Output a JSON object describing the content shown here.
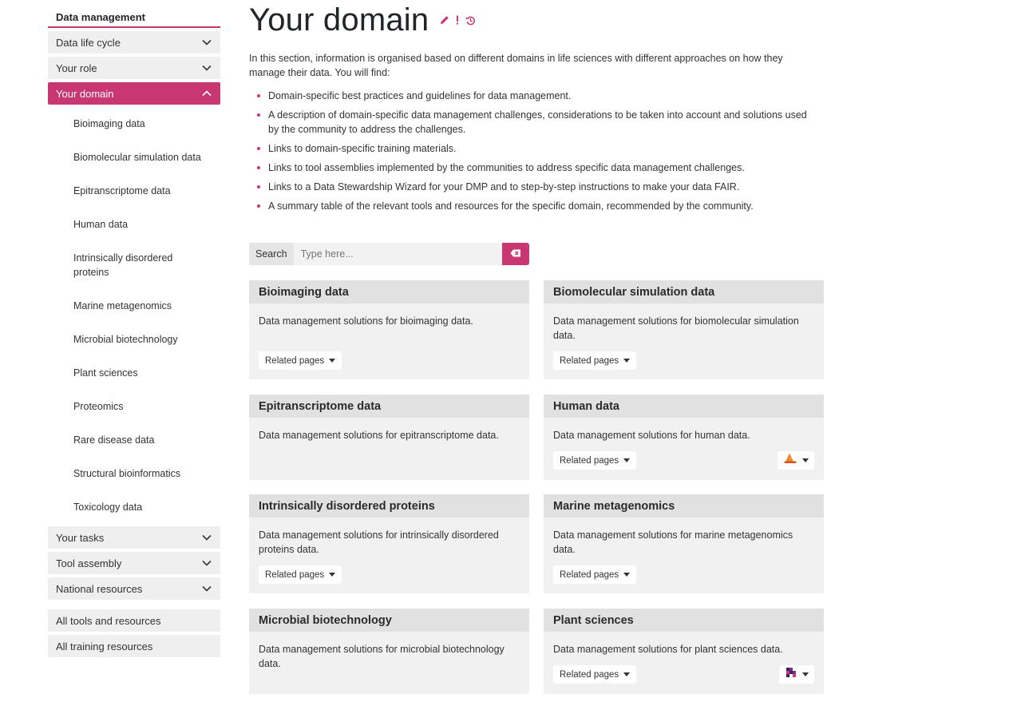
{
  "sidebar": {
    "heading": "Data management",
    "items": [
      {
        "label": "Data life cycle"
      },
      {
        "label": "Your role"
      },
      {
        "label": "Your domain"
      }
    ],
    "domain_subitems": [
      "Bioimaging data",
      "Biomolecular simulation data",
      "Epitranscriptome data",
      "Human data",
      "Intrinsically disordered proteins",
      "Marine metagenomics",
      "Microbial biotechnology",
      "Plant sciences",
      "Proteomics",
      "Rare disease data",
      "Structural bioinformatics",
      "Toxicology data"
    ],
    "items_after": [
      {
        "label": "Your tasks"
      },
      {
        "label": "Tool assembly"
      },
      {
        "label": "National resources"
      }
    ],
    "extra": [
      {
        "label": "All tools and resources"
      },
      {
        "label": "All training resources"
      }
    ]
  },
  "main": {
    "title": "Your domain",
    "title_icons": [
      "edit-pencil-icon",
      "exclamation-icon",
      "history-icon"
    ],
    "intro": "In this section, information is organised based on different domains in life sciences with different approaches on how they manage their data. You will find:",
    "bullets": [
      "Domain-specific best practices and guidelines for data management.",
      "A description of domain-specific data management challenges, considerations to be taken into account and solutions used by the community to address the challenges.",
      "Links to domain-specific training materials.",
      "Links to tool assemblies implemented by the communities to address specific data management challenges.",
      "Links to a Data Stewardship Wizard for your DMP and to step-by-step instructions to make your data FAIR.",
      "A summary table of the relevant tools and resources for the specific domain, recommended by the community."
    ]
  },
  "search": {
    "label": "Search",
    "placeholder": "Type here...",
    "clear_icon": "backspace-icon"
  },
  "related_label": "Related pages",
  "cards": [
    {
      "title": "Bioimaging data",
      "desc": "Data management solutions for bioimaging data.",
      "related": true
    },
    {
      "title": "Biomolecular simulation data",
      "desc": "Data management solutions for biomolecular simulation data.",
      "related": true
    },
    {
      "title": "Epitranscriptome data",
      "desc": "Data management solutions for epitranscriptome data.",
      "related": false
    },
    {
      "title": "Human data",
      "desc": "Data management solutions for human data.",
      "related": true,
      "tool_icon": "wizard-hat-icon"
    },
    {
      "title": "Intrinsically disordered proteins",
      "desc": "Data management solutions for intrinsically disordered proteins data.",
      "related": true
    },
    {
      "title": "Marine metagenomics",
      "desc": "Data management solutions for marine metagenomics data.",
      "related": true
    },
    {
      "title": "Microbial biotechnology",
      "desc": "Data management solutions for microbial biotechnology data.",
      "related": false
    },
    {
      "title": "Plant sciences",
      "desc": "Data management solutions for plant sciences data.",
      "related": true,
      "tool_icon": "pixel-logo-icon"
    }
  ],
  "colors": {
    "accent": "#c83771",
    "nav_bg": "#f0eff0",
    "card_bg": "#f2f1f2",
    "card_head_bg": "#e2e1e2"
  }
}
